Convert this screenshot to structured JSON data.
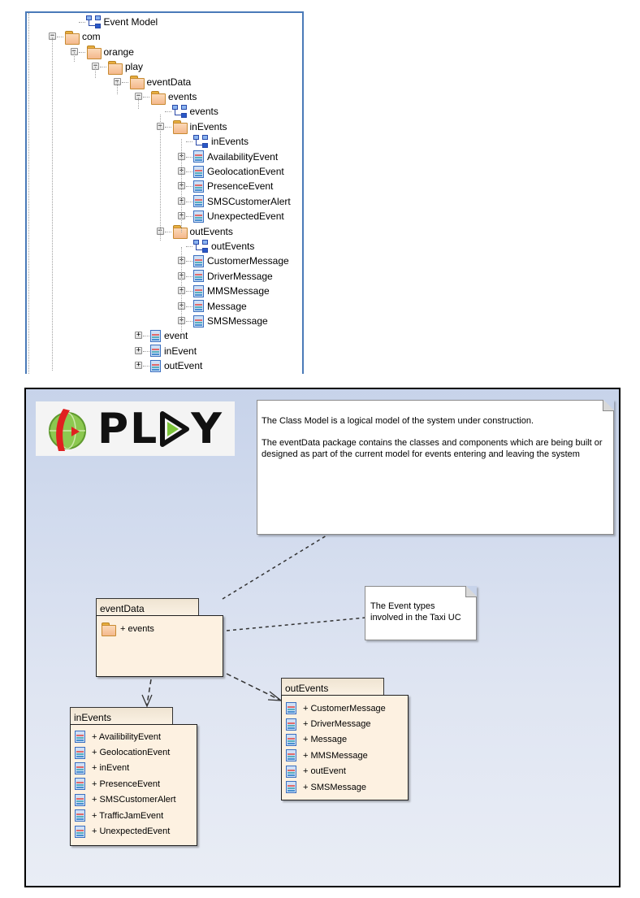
{
  "tree": {
    "nodes": [
      {
        "label": "Event Model",
        "icon": "diagram-icon"
      },
      {
        "label": "com",
        "icon": "folder-icon",
        "expander": "minus"
      },
      {
        "label": "orange",
        "icon": "folder-icon",
        "expander": "minus"
      },
      {
        "label": "play",
        "icon": "folder-icon",
        "expander": "minus"
      },
      {
        "label": "eventData",
        "icon": "folder-icon",
        "expander": "minus"
      },
      {
        "label": "events",
        "icon": "folder-icon",
        "expander": "minus"
      },
      {
        "label": "events",
        "icon": "diagram-icon"
      },
      {
        "label": "inEvents",
        "icon": "folder-icon",
        "expander": "minus"
      },
      {
        "label": "inEvents",
        "icon": "diagram-icon"
      },
      {
        "label": "AvailabilityEvent",
        "icon": "class-icon",
        "expander": "plus"
      },
      {
        "label": "GeolocationEvent",
        "icon": "class-icon",
        "expander": "plus"
      },
      {
        "label": "PresenceEvent",
        "icon": "class-icon",
        "expander": "plus"
      },
      {
        "label": "SMSCustomerAlert",
        "icon": "class-icon",
        "expander": "plus"
      },
      {
        "label": "UnexpectedEvent",
        "icon": "class-icon",
        "expander": "plus"
      },
      {
        "label": "outEvents",
        "icon": "folder-icon",
        "expander": "minus"
      },
      {
        "label": "outEvents",
        "icon": "diagram-icon"
      },
      {
        "label": "CustomerMessage",
        "icon": "class-icon",
        "expander": "plus"
      },
      {
        "label": "DriverMessage",
        "icon": "class-icon",
        "expander": "plus"
      },
      {
        "label": "MMSMessage",
        "icon": "class-icon",
        "expander": "plus"
      },
      {
        "label": "Message",
        "icon": "class-icon",
        "expander": "plus"
      },
      {
        "label": "SMSMessage",
        "icon": "class-icon",
        "expander": "plus"
      },
      {
        "label": "event",
        "icon": "class-icon",
        "expander": "plus"
      },
      {
        "label": "inEvent",
        "icon": "class-icon",
        "expander": "plus"
      },
      {
        "label": "outEvent",
        "icon": "class-icon",
        "expander": "plus"
      }
    ]
  },
  "diagram": {
    "logo_text": "PLAY",
    "main_note": {
      "line1": "The Class Model is a logical model of the system under construction.",
      "line2": "The eventData  package contains the classes and components which are being built or designed as part of the current model for events entering and leaving the system"
    },
    "taxi_note": "The Event types involved in the Taxi UC",
    "packages": {
      "eventData": {
        "name": "eventData",
        "items": [
          "+ events"
        ]
      },
      "inEvents": {
        "name": "inEvents",
        "items": [
          "+ AvailibilityEvent",
          "+ GeolocationEvent",
          "+ inEvent",
          "+ PresenceEvent",
          "+ SMSCustomerAlert",
          "+ TrafficJamEvent",
          "+ UnexpectedEvent"
        ]
      },
      "outEvents": {
        "name": "outEvents",
        "items": [
          "+ CustomerMessage",
          "+ DriverMessage",
          "+ Message",
          "+ MMSMessage",
          "+ outEvent",
          "+ SMSMessage"
        ]
      }
    },
    "colors": {
      "background": "#c7d3ea",
      "package_fill": "#fdf1e1",
      "note_fill": "#ffffff"
    }
  }
}
